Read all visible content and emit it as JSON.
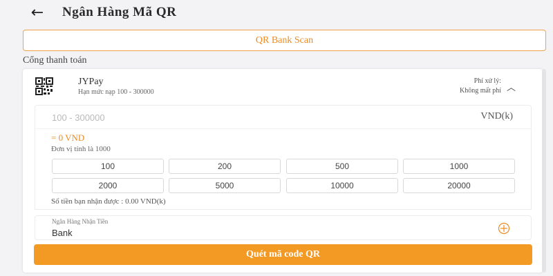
{
  "header": {
    "back_icon": "arrow-left-icon",
    "back_glyph": "←",
    "title": "Ngân Hàng Mã QR"
  },
  "scan_button": {
    "label": "QR Bank Scan"
  },
  "section_label": "Cổng thanh toán",
  "provider": {
    "icon": "qr-code-icon",
    "name": "JYPay",
    "limit": "Hạn mức nạp 100 - 300000",
    "fee_title": "Phí xử lý:",
    "fee_value": "Không mất phí",
    "chevron_icon": "chevron-up-icon",
    "chevron_glyph": "︿"
  },
  "amount": {
    "value": "",
    "placeholder": "100 - 300000",
    "unit": "VND(k)",
    "converted": "= 0 VND",
    "unit_note": "Đơn vị tính là 1000"
  },
  "quick_amounts": [
    "100",
    "200",
    "500",
    "1000",
    "2000",
    "5000",
    "10000",
    "20000"
  ],
  "receive_text": "Số tiền bạn nhận được : 0.00 VND(k)",
  "bank": {
    "label": "Ngân Hàng Nhận Tiền",
    "value": "Bank",
    "add_icon": "circle-plus-icon"
  },
  "submit_button": {
    "label": "Quét mã code QR"
  },
  "colors": {
    "accent": "#f39a25",
    "accent_text": "#ee8a1e",
    "background": "#f3f3f5"
  }
}
